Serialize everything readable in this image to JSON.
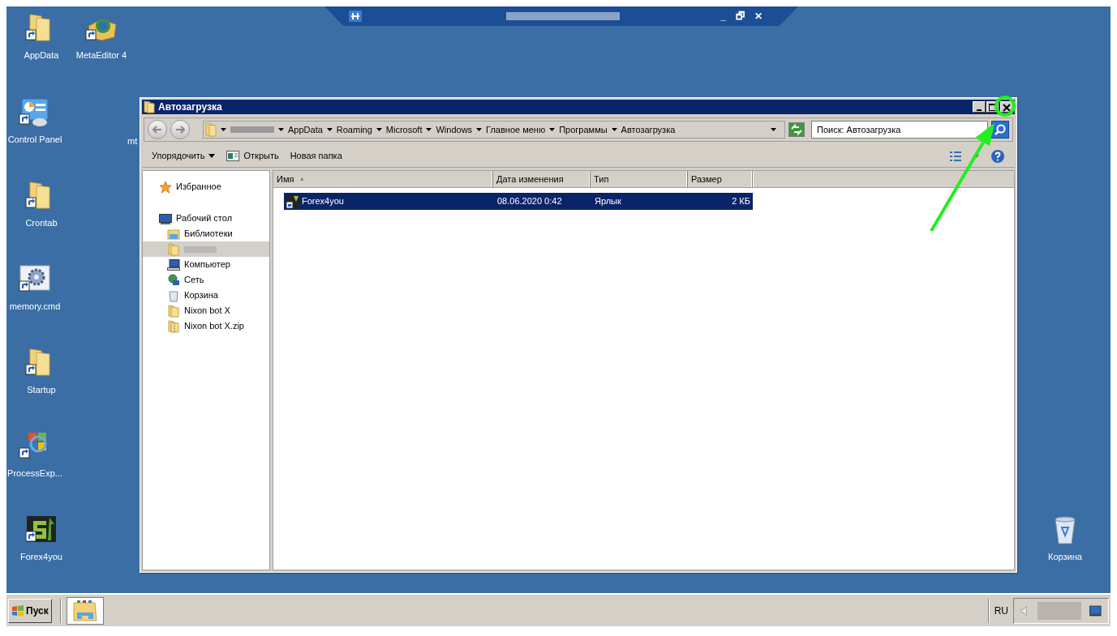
{
  "remote_bar": {
    "buttons": [
      "_",
      "🗗",
      "✕"
    ]
  },
  "desktop_icons": [
    {
      "label": "AppData",
      "kind": "folder",
      "shortcut": true
    },
    {
      "label": "MetaEditor 4",
      "kind": "book",
      "shortcut": true
    },
    {
      "label": "Control Panel",
      "kind": "panel",
      "shortcut": true
    },
    {
      "label": "mt",
      "kind": "hidden"
    },
    {
      "label": "Crontab",
      "kind": "folder",
      "shortcut": true
    },
    {
      "label": "memory.cmd",
      "kind": "gear",
      "shortcut": true
    },
    {
      "label": "Startup",
      "kind": "folder",
      "shortcut": true
    },
    {
      "label": "ProcessExp...",
      "kind": "app",
      "shortcut": true
    },
    {
      "label": "Forex4you",
      "kind": "app2",
      "shortcut": true
    },
    {
      "label": "Корзина",
      "kind": "recycle",
      "shortcut": false
    }
  ],
  "window": {
    "title": "Автозагрузка",
    "address": [
      {
        "redacted": true
      },
      {
        "label": "AppData",
        "redacted": false
      },
      {
        "label": "Roaming",
        "redacted": false
      },
      {
        "label": "Microsoft",
        "redacted": false
      },
      {
        "label": "Windows",
        "redacted": false
      },
      {
        "label": "Главное меню",
        "redacted": false
      },
      {
        "label": "Программы",
        "redacted": false
      },
      {
        "label": "Автозагрузка",
        "redacted": false
      }
    ],
    "search": {
      "placeholder": "Поиск: Автозагрузка"
    },
    "toolbar": [
      {
        "label": "Упорядочить",
        "kind": "menu"
      },
      {
        "label": "Открыть",
        "kind": "open"
      },
      {
        "label": "Новая папка",
        "kind": "plain"
      }
    ],
    "nav": [
      {
        "label": "Избранное",
        "kind": "star",
        "selected": false
      },
      {
        "label": "Рабочий стол",
        "kind": "desktop",
        "selected": false,
        "children": [
          {
            "label": "Библиотеки",
            "kind": "libraries",
            "selected": false
          },
          {
            "kind": "user",
            "selected": true
          },
          {
            "label": "Компьютер",
            "kind": "computer",
            "selected": false
          },
          {
            "label": "Сеть",
            "kind": "network",
            "selected": false
          },
          {
            "label": "Корзина",
            "kind": "recycle",
            "selected": false
          },
          {
            "label": "Nixon bot X",
            "kind": "folder",
            "selected": false
          },
          {
            "label": "Nixon bot X.zip",
            "kind": "zip",
            "selected": false
          }
        ]
      }
    ],
    "columns": [
      {
        "label": "Имя",
        "sort": "▴"
      },
      {
        "label": "Дата изменения"
      },
      {
        "label": "Тип"
      },
      {
        "label": "Размер"
      }
    ],
    "rows": [
      {
        "name": "Forex4you",
        "date": "08.06.2020 0:42",
        "type": "Ярлык",
        "size": "2 КБ",
        "selected": true
      }
    ]
  },
  "taskbar": {
    "start": "Пуск",
    "language": "RU"
  }
}
